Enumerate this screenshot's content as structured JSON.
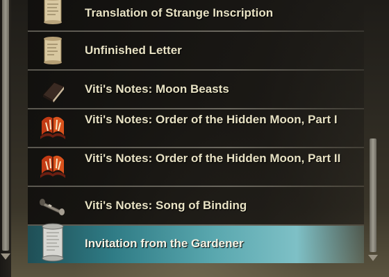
{
  "inventory_list": {
    "items": [
      {
        "label": "Translation of Strange Inscription",
        "icon": "scroll-icon"
      },
      {
        "label": "Unfinished Letter",
        "icon": "scroll-icon"
      },
      {
        "label": "Viti's Notes: Moon Beasts",
        "icon": "book-icon"
      },
      {
        "label": "Viti's Notes: Order of the Hidden Moon, Part I",
        "icon": "open-book-icon"
      },
      {
        "label": "Viti's Notes: Order of the Hidden Moon, Part II",
        "icon": "open-book-icon"
      },
      {
        "label": "Viti's Notes: Song of Binding",
        "icon": "rolled-scroll-icon"
      },
      {
        "label": "Invitation from the Gardener",
        "icon": "parchment-scroll-icon",
        "selected": true
      }
    ]
  },
  "colors": {
    "text": "#e8e2c4",
    "selected_highlight": "#59a7ae",
    "row_background": "#161512"
  }
}
